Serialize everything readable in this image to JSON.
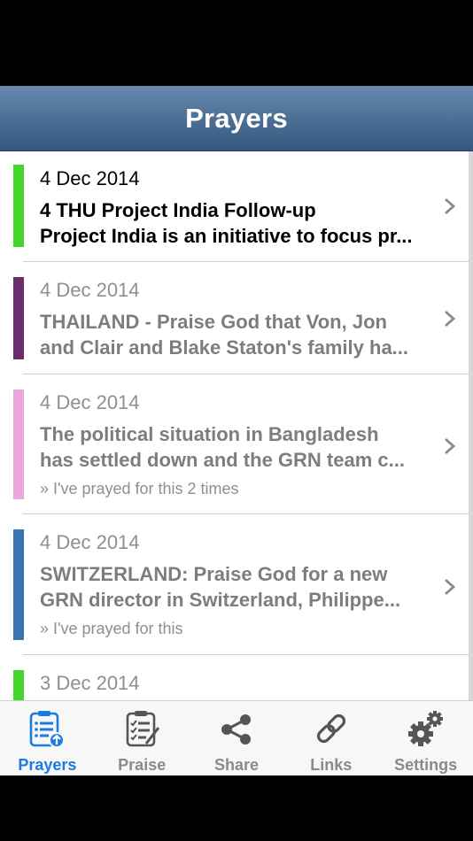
{
  "nav": {
    "title": "Prayers"
  },
  "prayers": [
    {
      "date": "4 Dec 2014",
      "line1": "4 THU    Project India Follow-up",
      "line2": "Project India is an initiative to focus pr...",
      "meta": "",
      "color": "#44d62c"
    },
    {
      "date": "4 Dec 2014",
      "line1": "THAILAND - Praise God that Von, Jon",
      "line2": "and Clair and Blake Staton's family ha...",
      "meta": "",
      "color": "#6b2c6b"
    },
    {
      "date": "4 Dec 2014",
      "line1": "The political situation in Bangladesh",
      "line2": "has settled down and the GRN team c...",
      "meta": "» I've prayed for this 2 times",
      "color": "#efa6de"
    },
    {
      "date": "4 Dec 2014",
      "line1": "SWITZERLAND: Praise God for a new",
      "line2": "GRN director in Switzerland, Philippe...",
      "meta": "» I've prayed for this",
      "color": "#3b74b3"
    },
    {
      "date": "3 Dec 2014",
      "line1": "",
      "line2": "",
      "meta": "",
      "color": "#44d62c"
    }
  ],
  "tabs": [
    {
      "label": "Prayers",
      "icon": "prayer-list-icon",
      "active": true
    },
    {
      "label": "Praise",
      "icon": "praise-checklist-icon",
      "active": false
    },
    {
      "label": "Share",
      "icon": "share-icon",
      "active": false
    },
    {
      "label": "Links",
      "icon": "link-icon",
      "active": false
    },
    {
      "label": "Settings",
      "icon": "gear-icon",
      "active": false
    }
  ],
  "colors": {
    "accent": "#1a7be0",
    "nav_top": "#6889ad",
    "nav_bottom": "#34577f"
  }
}
